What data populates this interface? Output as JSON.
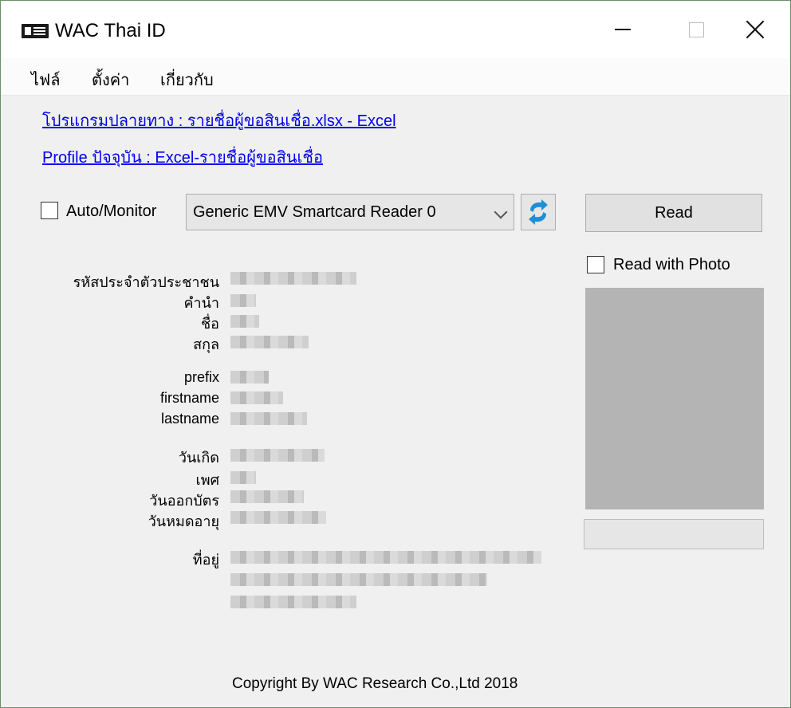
{
  "window": {
    "title": "WAC Thai ID"
  },
  "menu": {
    "items": [
      "ไฟล์",
      "ตั้งค่า",
      "เกี่ยวกับ"
    ]
  },
  "links": {
    "program": "โปรแกรมปลายทาง : รายชื่อผู้ขอสินเชื่อ.xlsx - Excel",
    "profile": "Profile ปัจจุบัน : Excel-รายชื่อผู้ขอสินเชื่อ"
  },
  "controls": {
    "auto_monitor": {
      "label": "Auto/Monitor",
      "checked": false
    },
    "reader": {
      "selected": "Generic EMV Smartcard Reader 0"
    },
    "read_button": "Read",
    "read_with_photo": {
      "label": "Read with Photo",
      "checked": false
    }
  },
  "fields": {
    "citizen_id": "รหัสประจำตัวประชาชน",
    "title_th": "คำนำ",
    "firstname_th": "ชื่อ",
    "lastname_th": "สกุล",
    "prefix": "prefix",
    "firstname": "firstname",
    "lastname": "lastname",
    "birthdate": "วันเกิด",
    "gender": "เพศ",
    "issue_date": "วันออกบัตร",
    "expiry_date": "วันหมดอายุ",
    "address": "ที่อยู่"
  },
  "footer": {
    "copyright": "Copyright By WAC Research Co.,Ltd 2018"
  },
  "icons": {
    "app": "id-card-icon",
    "refresh": "refresh-icon",
    "dropdown": "chevron-down-icon"
  },
  "colors": {
    "link": "#0000ee",
    "refresh_blue": "#1e8fd6",
    "photo_bg": "#b4b4b4"
  }
}
